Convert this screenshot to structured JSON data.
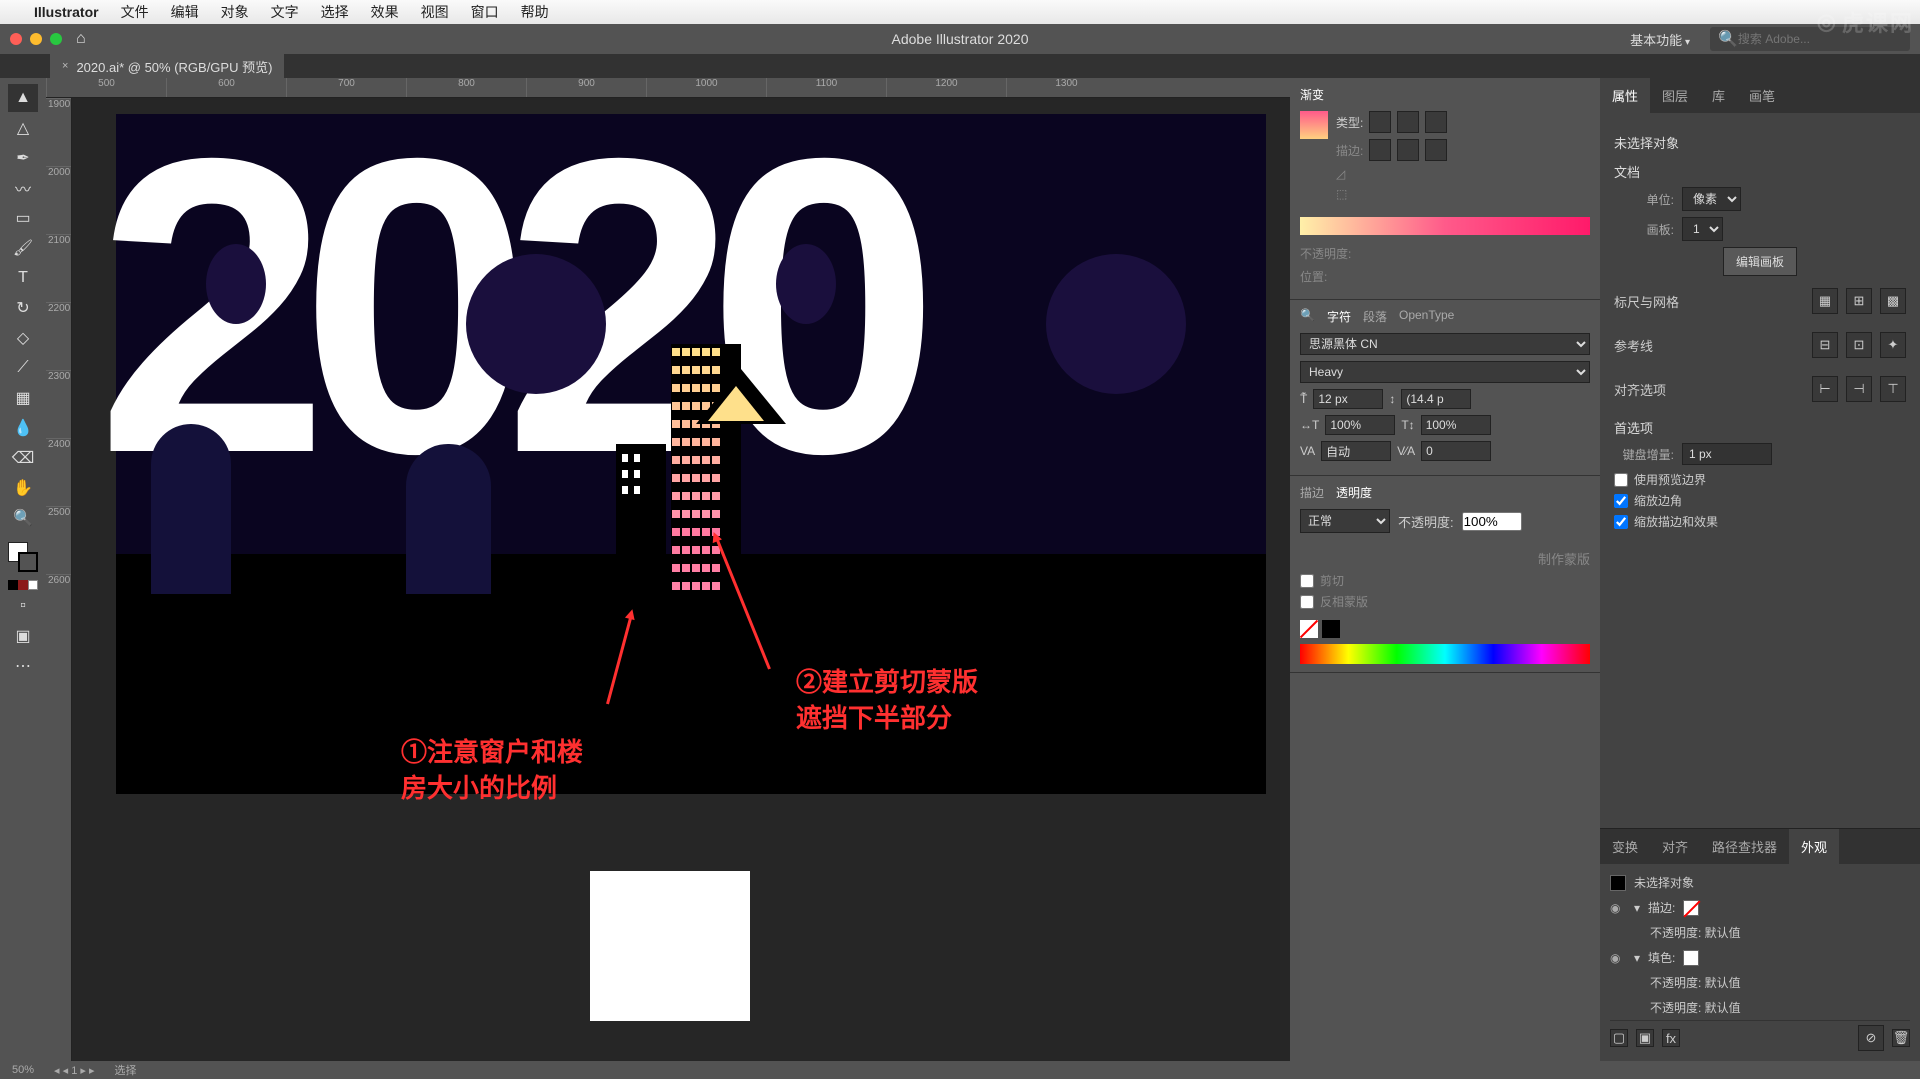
{
  "mac_menu": {
    "app": "Illustrator",
    "items": [
      "文件",
      "编辑",
      "对象",
      "文字",
      "选择",
      "效果",
      "视图",
      "窗口",
      "帮助"
    ]
  },
  "app_bar": {
    "title": "Adobe Illustrator 2020",
    "workspace": "基本功能",
    "search_placeholder": "搜索 Adobe..."
  },
  "watermark": "虎课网",
  "doc_tab": "2020.ai* @ 50% (RGB/GPU 预览)",
  "ruler_h": [
    "500",
    "600",
    "700",
    "800",
    "900",
    "1000",
    "1100",
    "1200",
    "1300"
  ],
  "ruler_v": [
    "1900",
    "2000",
    "2100",
    "2200",
    "2300",
    "2400",
    "2500",
    "2600"
  ],
  "annotations": {
    "a1_l1": "①注意窗户和楼",
    "a1_l2": "房大小的比例",
    "a2_l1": "②建立剪切蒙版",
    "a2_l2": "遮挡下半部分"
  },
  "gradient": {
    "title": "渐变",
    "type_label": "类型:",
    "stroke_label": "描边:",
    "opacity_label": "不透明度:",
    "position_label": "位置:"
  },
  "character": {
    "tabs": [
      "字符",
      "段落",
      "OpenType"
    ],
    "font_family": "思源黑体 CN",
    "font_weight": "Heavy",
    "size": "12 px",
    "leading": "(14.4 p",
    "hscale": "100%",
    "vscale": "100%",
    "kerning": "自动",
    "tracking": "0"
  },
  "stroke_opacity": {
    "tabs": [
      "描边",
      "透明度"
    ],
    "blend": "正常",
    "opacity_label": "不透明度:",
    "opacity": "100%",
    "make_mask": "制作蒙版",
    "clip": "剪切",
    "invert": "反相蒙版"
  },
  "properties": {
    "tabs": [
      "属性",
      "图层",
      "库",
      "画笔"
    ],
    "no_sel": "未选择对象",
    "doc_h": "文档",
    "units_label": "单位:",
    "units": "像素",
    "artboard_label": "画板:",
    "artboard": "1",
    "edit_artboard": "编辑画板",
    "ruler_grid": "标尺与网格",
    "guides": "参考线",
    "align_opts": "对齐选项",
    "prefs": "首选项",
    "key_inc_label": "键盘增量:",
    "key_inc": "1 px",
    "use_preview": "使用预览边界",
    "scale_corners": "缩放边角",
    "scale_stroke": "缩放描边和效果"
  },
  "second_tabs": [
    "变换",
    "对齐",
    "路径查找器",
    "外观"
  ],
  "appearance": {
    "no_sel": "未选择对象",
    "stroke": "描边:",
    "opacity1": "不透明度: 默认值",
    "fill": "填色:",
    "opacity2": "不透明度: 默认值",
    "opacity3": "不透明度: 默认值"
  },
  "status": {
    "zoom": "50%",
    "nav": "1",
    "sel": "选择"
  }
}
